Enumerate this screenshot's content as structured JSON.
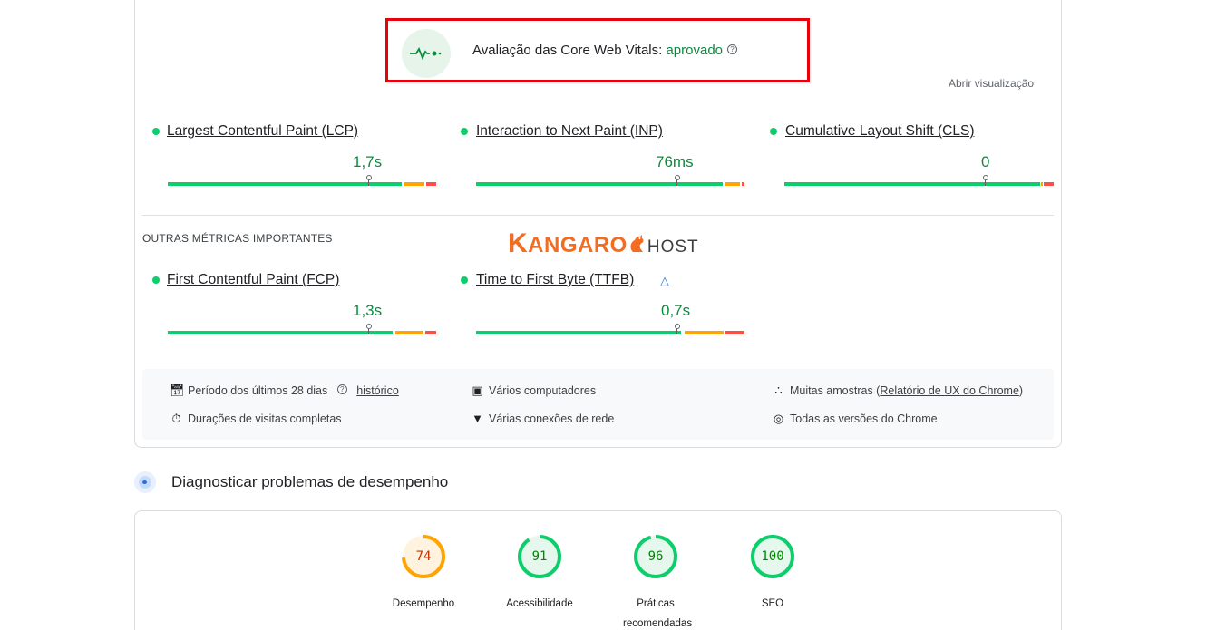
{
  "assessment": {
    "prefix": "Avaliação das Core Web Vitals: ",
    "status": "aprovado",
    "help": "?",
    "open_view": "Abrir visualização"
  },
  "core_metrics": [
    {
      "name": "Largest Contentful Paint (LCP)",
      "value": "1,7s"
    },
    {
      "name": "Interaction to Next Paint (INP)",
      "value": "76ms"
    },
    {
      "name": "Cumulative Layout Shift (CLS)",
      "value": "0"
    }
  ],
  "other_metrics": {
    "label": "OUTRAS MÉTRICAS IMPORTANTES",
    "items": [
      {
        "name": "First Contentful Paint (FCP)",
        "value": "1,3s"
      },
      {
        "name": "Time to First Byte (TTFB)",
        "value": "0,7s"
      }
    ]
  },
  "logo": {
    "k": "K",
    "angaro": "ANGARO",
    "host": "HOST"
  },
  "info": {
    "period": "Período dos últimos 28 dias",
    "history_link": "histórico",
    "computers": "Vários computadores",
    "samples_prefix": "Muitas amostras (",
    "samples_link": "Relatório de UX do Chrome",
    "samples_suffix": ")",
    "visits": "Durações de visitas completas",
    "network": "Várias conexões de rede",
    "versions": "Todas as versões do Chrome"
  },
  "diagnostics": {
    "title": "Diagnosticar problemas de desempenho",
    "scores": [
      {
        "value": "74",
        "label": "Desempenho",
        "color": "#c33300",
        "ring": "#ffa400",
        "bg": "#fff3e0"
      },
      {
        "value": "91",
        "label": "Acessibilidade",
        "color": "#008800",
        "ring": "#0cce6b",
        "bg": "#e6f8ee"
      },
      {
        "value": "96",
        "label": "Práticas recomendadas",
        "color": "#008800",
        "ring": "#0cce6b",
        "bg": "#e6f8ee"
      },
      {
        "value": "100",
        "label": "SEO",
        "color": "#008800",
        "ring": "#0cce6b",
        "bg": "#e6f8ee"
      }
    ]
  },
  "colors": {
    "good": "#0cce6b",
    "needs_improvement": "#ffa400",
    "poor": "#ff4e42",
    "highlight_border": "#e8000b"
  }
}
